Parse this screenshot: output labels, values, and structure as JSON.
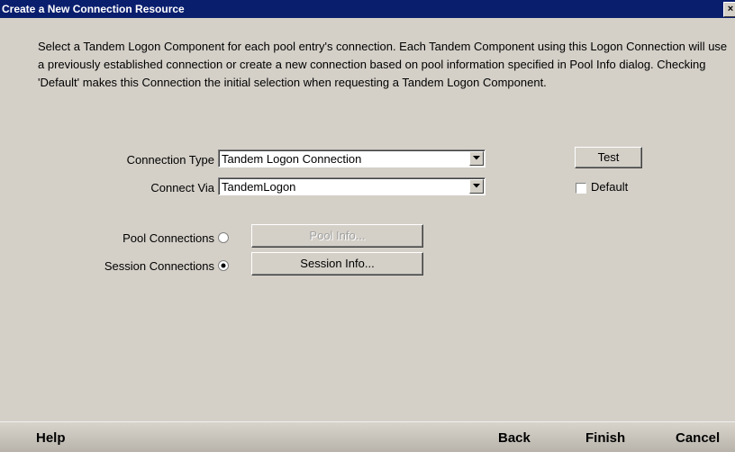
{
  "window": {
    "title": "Create a New Connection Resource",
    "close_glyph": "×"
  },
  "description": "Select a Tandem Logon Component for each pool entry's connection. Each Tandem Component using this Logon Connection will use a previously established connection or create a new connection based on pool information specified in Pool Info dialog. Checking 'Default' makes this Connection the initial selection when requesting a Tandem Logon Component.",
  "form": {
    "connection_type_label": "Connection Type",
    "connection_type_value": "Tandem Logon Connection",
    "connect_via_label": "Connect Via",
    "connect_via_value": "TandemLogon",
    "test_button": "Test",
    "default_label": "Default",
    "default_checked": false,
    "pool_connections_label": "Pool Connections",
    "pool_connections_selected": false,
    "pool_info_button": "Pool Info...",
    "session_connections_label": "Session Connections",
    "session_connections_selected": true,
    "session_info_button": "Session Info..."
  },
  "footer": {
    "help": "Help",
    "back": "Back",
    "finish": "Finish",
    "cancel": "Cancel"
  },
  "colors": {
    "titlebar": "#0a1e6e",
    "dialog_bg": "#d4d0c8"
  }
}
